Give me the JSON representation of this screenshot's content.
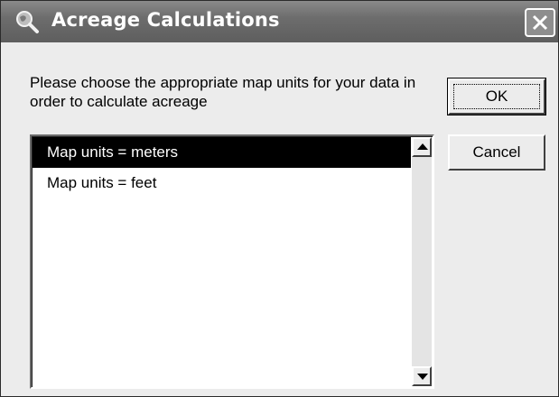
{
  "window": {
    "title": "Acreage Calculations",
    "title_icon": "magnifier-globe-icon",
    "close_icon": "close-icon"
  },
  "dialog": {
    "prompt": "Please choose the appropriate map units for your data in order to calculate acreage",
    "ok_label": "OK",
    "cancel_label": "Cancel"
  },
  "listbox": {
    "selected_index": 0,
    "items": [
      {
        "label": "Map units = meters",
        "selected": true
      },
      {
        "label": "Map units = feet",
        "selected": false
      }
    ]
  },
  "colors": {
    "titlebar": "#6d6d6d",
    "selection": "#000000",
    "background": "#ececec"
  }
}
